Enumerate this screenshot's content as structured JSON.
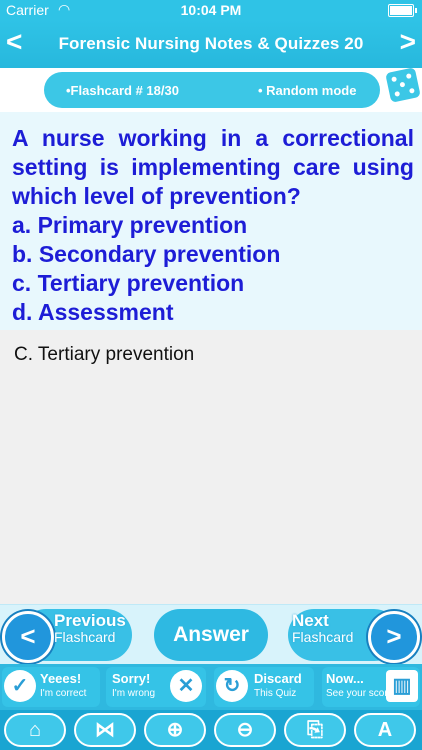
{
  "status_bar": {
    "carrier": "Carrier",
    "time": "10:04 PM"
  },
  "nav": {
    "title": "Forensic Nursing Notes & Quizzes 20",
    "back_icon": "chevron-left-icon",
    "forward_icon": "chevron-right-icon"
  },
  "info": {
    "flashcard": "•Flashcard #  18/30",
    "mode": "• Random mode"
  },
  "question": {
    "text": "A nurse working in a correctional setting is implementing care using which level of prevention?",
    "options": [
      "a. Primary prevention",
      "b. Secondary prevention",
      "c. Tertiary prevention",
      "d. Assessment"
    ]
  },
  "answer": {
    "text": "C. Tertiary prevention"
  },
  "controls": {
    "previous_title": "Previous",
    "previous_sub": "Flashcard",
    "answer_label": "Answer",
    "next_title": "Next",
    "next_sub": "Flashcard"
  },
  "actions": {
    "yes_title": "Yeees!",
    "yes_sub": "I'm correct",
    "sorry_title": "Sorry!",
    "sorry_sub": "I'm wrong",
    "discard_title": "Discard",
    "discard_sub": "This Quiz",
    "now_title": "Now...",
    "now_sub": "See your score"
  },
  "toolbar": {
    "home": "⌂",
    "share": "⋈",
    "zoom_in": "⊕",
    "zoom_out": "⊖",
    "bookmark": "⎘",
    "font": "A"
  },
  "colors": {
    "accent": "#2fc3e6",
    "question_text": "#1d1dd6"
  }
}
